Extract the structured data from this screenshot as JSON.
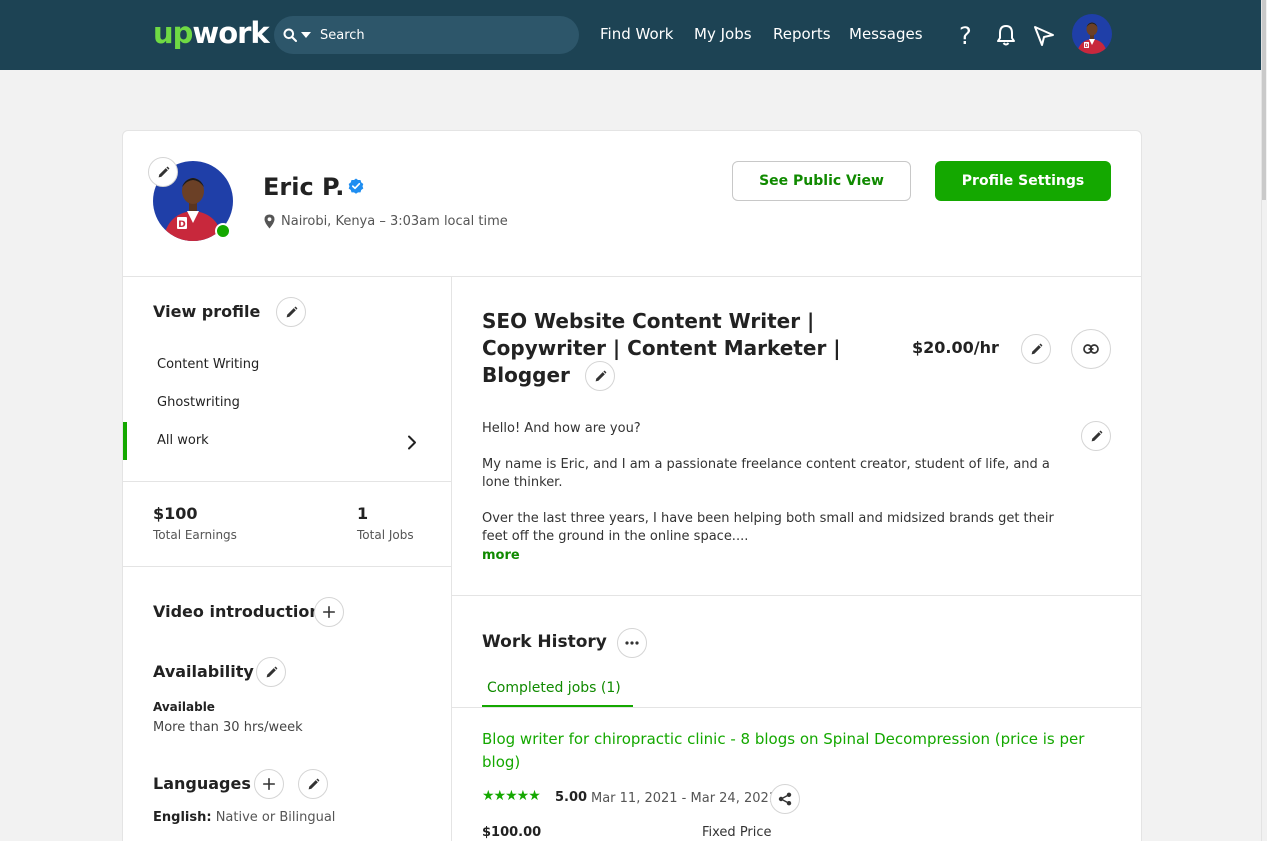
{
  "header": {
    "logo_up": "up",
    "logo_work": "work",
    "search_placeholder": "Search",
    "nav": [
      "Find Work",
      "My Jobs",
      "Reports",
      "Messages"
    ],
    "help_glyph": "?"
  },
  "profile": {
    "name": "Eric P.",
    "location": "Nairobi, Kenya – 3:03am local time",
    "see_public_view": "See Public View",
    "profile_settings": "Profile Settings"
  },
  "sidebar": {
    "view_profile": "View profile",
    "items": [
      "Content Writing",
      "Ghostwriting",
      "All work"
    ],
    "earnings_value": "$100",
    "earnings_label": "Total Earnings",
    "jobs_value": "1",
    "jobs_label": "Total Jobs",
    "video_intro": "Video introduction",
    "availability": "Availability",
    "availability_status": "Available",
    "availability_hours": "More than 30 hrs/week",
    "languages": "Languages",
    "language_name": "English:",
    "language_level": "Native or Bilingual"
  },
  "main": {
    "title": "SEO Website Content Writer | Copywriter | Content Marketer | Blogger",
    "rate": "$20.00/hr",
    "overview": [
      "Hello! And how are you?",
      "My name is Eric, and I am a passionate freelance content creator, student of life, and a lone thinker.",
      "Over the last three years, I have been helping both small and midsized brands get their feet off the ground in the online space...."
    ],
    "more": "more",
    "work_history": "Work History",
    "completed_tab": "Completed jobs (1)",
    "job": {
      "title": "Blog writer for chiropractic clinic - 8 blogs on Spinal Decompression (price is per blog)",
      "stars": "★★★★★",
      "score": "5.00",
      "dates": "Mar 11, 2021 - Mar 24, 2021",
      "amount": "$100.00",
      "price_type": "Fixed Price"
    }
  },
  "colors": {
    "header_bg": "#1d4354",
    "brand_green": "#14a800",
    "link_green": "#108a00"
  }
}
